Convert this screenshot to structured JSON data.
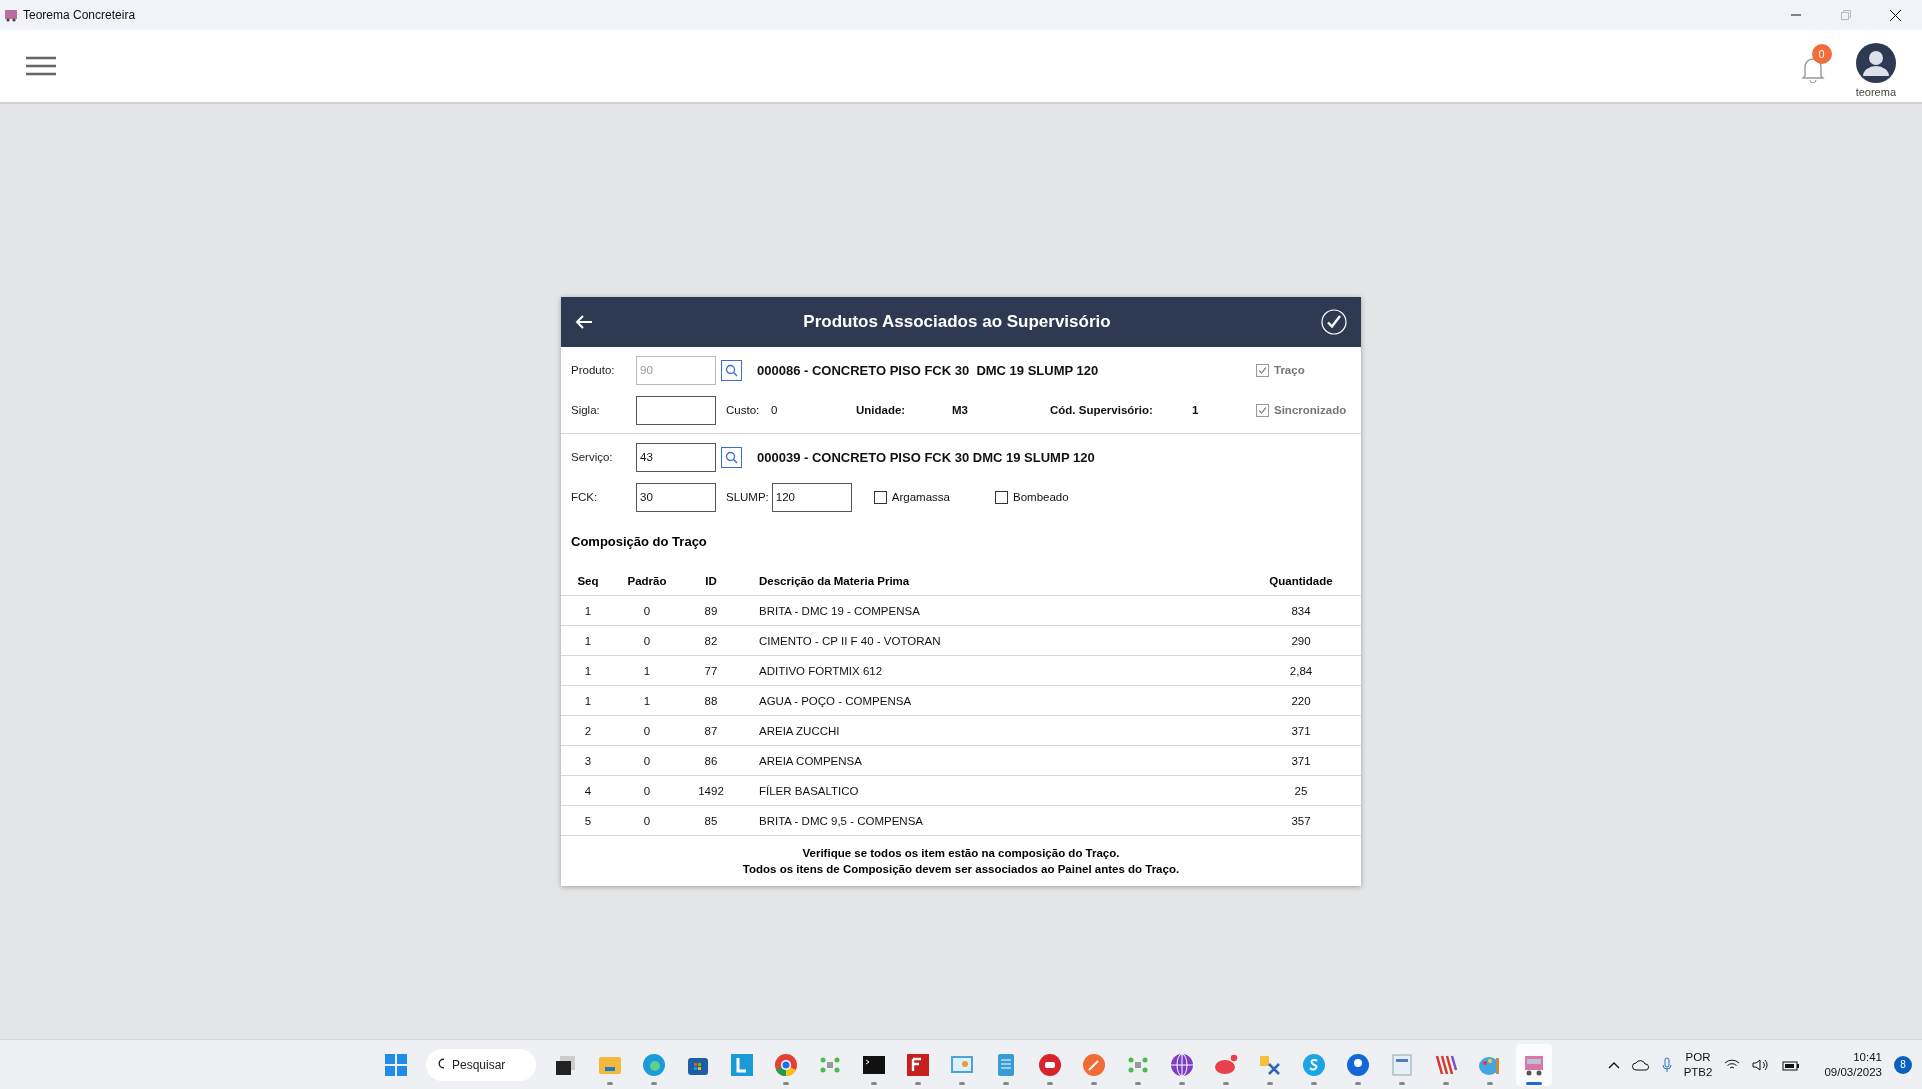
{
  "window": {
    "title": "Teorema Concreteira"
  },
  "header": {
    "notifications": "0",
    "user": "teorema"
  },
  "dialog": {
    "title": "Produtos Associados ao Supervisório",
    "produto": {
      "label": "Produto:",
      "value": "90",
      "disabled": true,
      "description": "000086 - CONCRETO PISO FCK 30  DMC 19 SLUMP 120"
    },
    "sigla": {
      "label": "Sigla:"
    },
    "custo": {
      "label": "Custo:",
      "value": "0"
    },
    "unidade": {
      "label": "Unidade:",
      "value": "M3"
    },
    "cod_supervisorio": {
      "label": "Cód. Supervisório:",
      "value": "1"
    },
    "flags": [
      {
        "label": "Traço",
        "checked": true,
        "disabled": true
      },
      {
        "label": "Sincronizado",
        "checked": true,
        "disabled": true
      }
    ],
    "servico": {
      "label": "Serviço:",
      "value": "43",
      "description": "000039 - CONCRETO PISO FCK 30 DMC 19 SLUMP 120"
    },
    "fck": {
      "label": "FCK:",
      "value": "30"
    },
    "slump": {
      "label": "SLUMP:",
      "value": "120"
    },
    "options": [
      {
        "label": "Argamassa",
        "checked": false
      },
      {
        "label": "Bombeado",
        "checked": false
      }
    ],
    "section_title": "Composição do Traço",
    "table": {
      "columns": [
        "Seq",
        "Padrão",
        "ID",
        "Descrição da Materia Prima",
        "Quantidade"
      ],
      "rows": [
        [
          "1",
          "0",
          "89",
          "BRITA - DMC 19 - COMPENSA",
          "834"
        ],
        [
          "1",
          "0",
          "82",
          "CIMENTO - CP II F 40 - VOTORAN",
          "290"
        ],
        [
          "1",
          "1",
          "77",
          "ADITIVO FORTMIX 612",
          "2,84"
        ],
        [
          "1",
          "1",
          "88",
          "AGUA - POÇO - COMPENSA",
          "220"
        ],
        [
          "2",
          "0",
          "87",
          "AREIA ZUCCHI",
          "371"
        ],
        [
          "3",
          "0",
          "86",
          "AREIA COMPENSA",
          "371"
        ],
        [
          "4",
          "0",
          "1492",
          "FÍLER BASALTICO",
          "25"
        ],
        [
          "5",
          "0",
          "85",
          "BRITA - DMC 9,5 - COMPENSA",
          "357"
        ]
      ]
    },
    "notes": [
      "Verifique se todos os item estão na composição do Traço.",
      "Todos os itens de Composição devem ser associados ao Painel antes do Traço."
    ]
  },
  "taskbar": {
    "search": {
      "placeholder": "Pesquisar"
    },
    "apps": [
      {
        "kind": "taskview",
        "running": false,
        "selected": false
      },
      {
        "kind": "folder",
        "running": true,
        "selected": false
      },
      {
        "kind": "browser",
        "running": true,
        "selected": false
      },
      {
        "kind": "store",
        "running": false,
        "selected": false
      },
      {
        "kind": "tile",
        "running": false,
        "selected": false
      },
      {
        "kind": "chrome",
        "running": true,
        "selected": false
      },
      {
        "kind": "network",
        "running": false,
        "selected": false
      },
      {
        "kind": "terminal",
        "running": true,
        "selected": false
      },
      {
        "kind": "ftp",
        "running": true,
        "selected": false
      },
      {
        "kind": "monitor",
        "running": true,
        "selected": false
      },
      {
        "kind": "notepad",
        "running": true,
        "selected": false
      },
      {
        "kind": "redcircle",
        "running": true,
        "selected": false
      },
      {
        "kind": "orange",
        "running": true,
        "selected": false
      },
      {
        "kind": "network",
        "running": true,
        "selected": false
      },
      {
        "kind": "globe",
        "running": true,
        "selected": false
      },
      {
        "kind": "chat",
        "running": true,
        "selected": false
      },
      {
        "kind": "tools",
        "running": true,
        "selected": false
      },
      {
        "kind": "skype",
        "running": true,
        "selected": false
      },
      {
        "kind": "pin",
        "running": true,
        "selected": false
      },
      {
        "kind": "doc",
        "running": true,
        "selected": false
      },
      {
        "kind": "stripes",
        "running": true,
        "selected": false
      },
      {
        "kind": "paint",
        "running": true,
        "selected": false
      },
      {
        "kind": "truck",
        "running": true,
        "selected": true
      }
    ],
    "tray": {
      "language": "POR",
      "layout": "PTB2",
      "time": "10:41",
      "date": "09/03/2023",
      "badge": "8"
    }
  }
}
